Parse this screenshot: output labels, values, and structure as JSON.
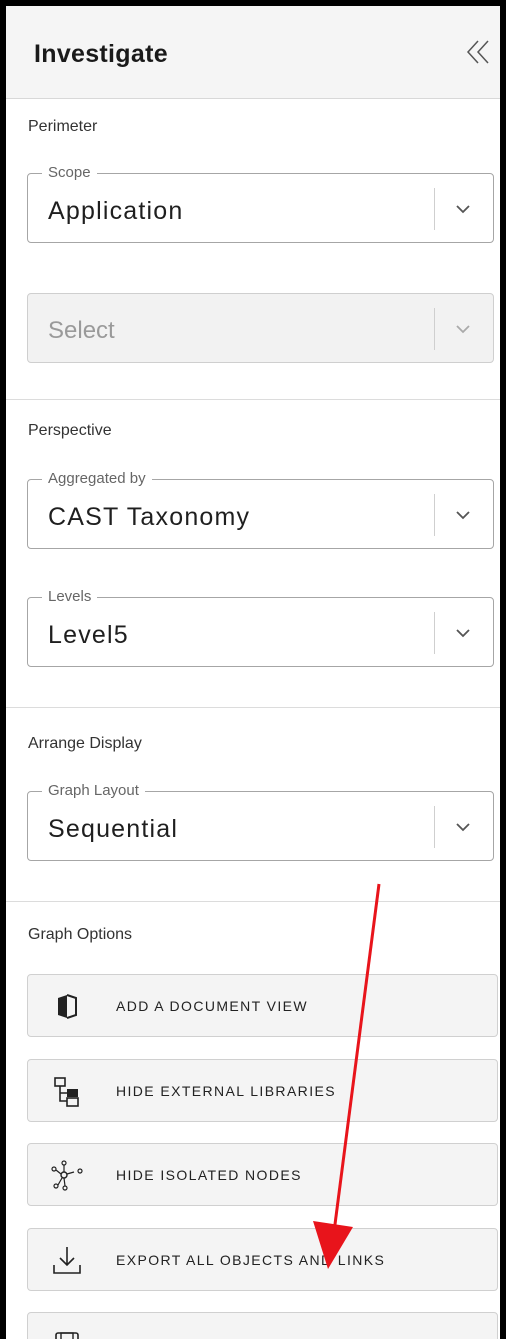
{
  "panel": {
    "title": "Investigate"
  },
  "perimeter": {
    "label": "Perimeter",
    "scope": {
      "legend": "Scope",
      "value": "Application"
    },
    "select": {
      "value": "Select"
    }
  },
  "perspective": {
    "label": "Perspective",
    "aggregated": {
      "legend": "Aggregated by",
      "value": "CAST Taxonomy"
    },
    "levels": {
      "legend": "Levels",
      "value": "Level5"
    }
  },
  "arrange": {
    "label": "Arrange Display",
    "layout": {
      "legend": "Graph Layout",
      "value": "Sequential"
    }
  },
  "graph_options": {
    "label": "Graph Options",
    "items": [
      {
        "label": "ADD A DOCUMENT VIEW",
        "icon": "document-view-icon"
      },
      {
        "label": "HIDE EXTERNAL LIBRARIES",
        "icon": "hierarchy-icon"
      },
      {
        "label": "HIDE ISOLATED NODES",
        "icon": "isolated-nodes-icon"
      },
      {
        "label": "EXPORT ALL OBJECTS AND LINKS",
        "icon": "download-icon"
      },
      {
        "label": "",
        "icon": "save-icon"
      }
    ]
  },
  "colors": {
    "accent": "#e8141b",
    "field_border": "#a6a6a6",
    "header_bg": "#f5f5f5"
  }
}
